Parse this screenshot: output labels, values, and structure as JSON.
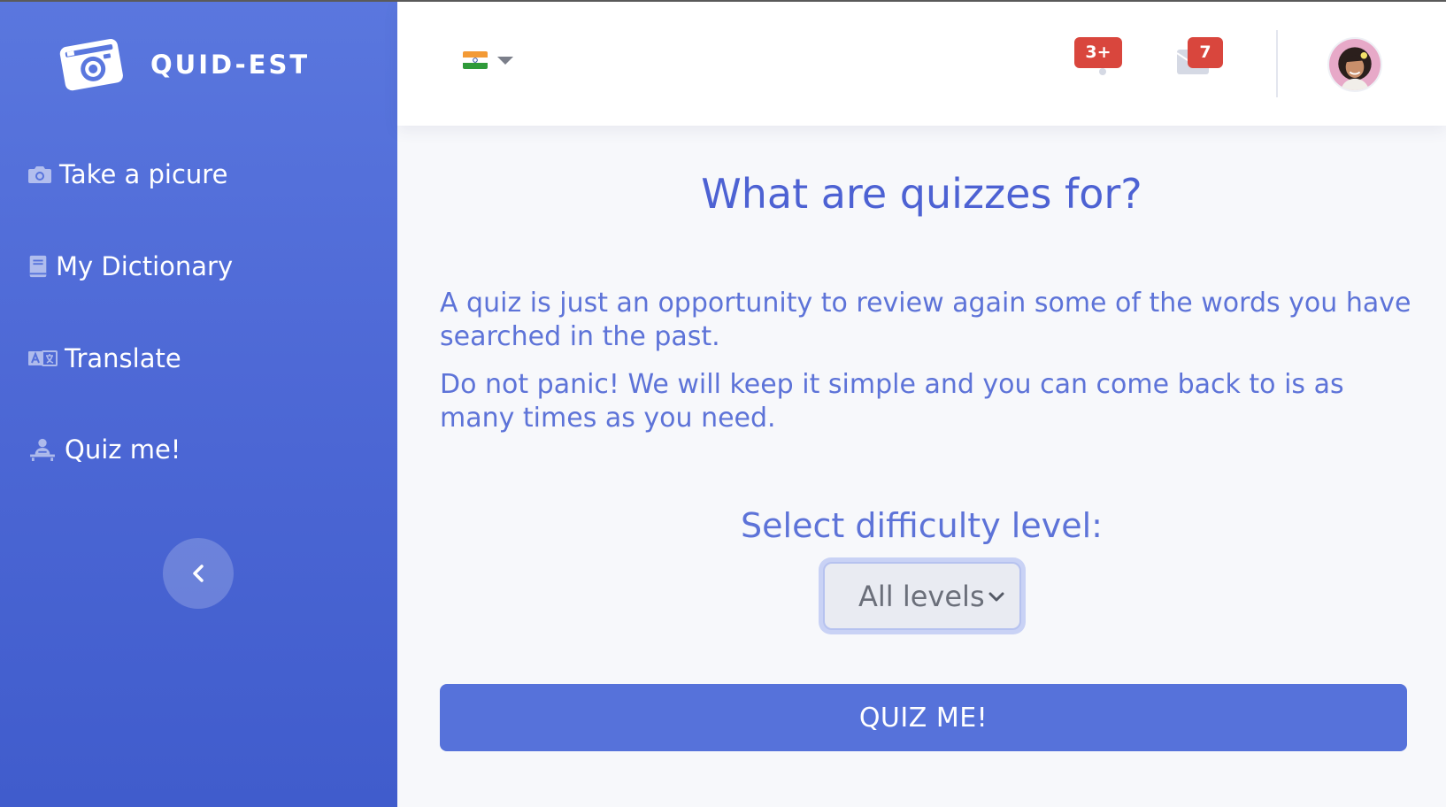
{
  "brand": {
    "name": "QUID-EST",
    "icon": "camera-logo-icon"
  },
  "sidebar": {
    "items": [
      {
        "label": "Take a picure",
        "icon": "camera-icon"
      },
      {
        "label": "My Dictionary",
        "icon": "book-icon"
      },
      {
        "label": "Translate",
        "icon": "translate-icon"
      },
      {
        "label": "Quiz me!",
        "icon": "teacher-icon"
      }
    ],
    "collapse_icon": "chevron-left-icon"
  },
  "topbar": {
    "language": {
      "flag": "india-flag-icon",
      "caret": "caret-down-icon"
    },
    "alerts": {
      "badge": "3+",
      "icon": "bell-icon"
    },
    "messages": {
      "badge": "7",
      "icon": "envelope-icon"
    },
    "avatar": "user-avatar"
  },
  "main": {
    "title": "What are quizzes for?",
    "paragraph1": "A quiz is just an opportunity to review again some of the words you have searched in the past.",
    "paragraph2": "Do not panic! We will keep it simple and you can come back to is as many times as you need.",
    "difficulty_label": "Select difficulty level:",
    "difficulty_selected": "All levels",
    "quiz_button": "QUIZ ME!"
  },
  "colors": {
    "sidebar_top": "#5a77de",
    "sidebar_bottom": "#405ccc",
    "accent": "#5672da",
    "title_text": "#4d62d3",
    "badge": "#d9463d"
  }
}
